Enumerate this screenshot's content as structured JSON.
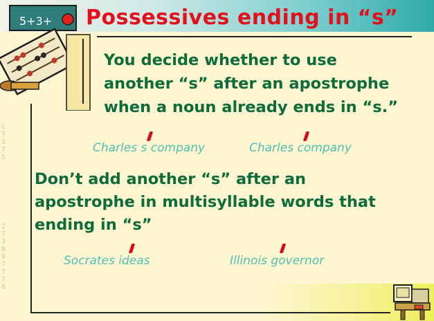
{
  "slide": {
    "title": "Possessives ending in “s”",
    "rule1": "You decide whether to use\nanother “s” after an apostrophe\nwhen a noun already ends in “s.”",
    "example1a": "Charles s company",
    "example1b": "Charles   company",
    "rule2": "Don’t add another “s” after an\napostrophe in multisyllable words that\nending in “s”",
    "example2a": "Socrates  ideas",
    "example2b": "Illinois  governor",
    "side_text_1": "CTSTS",
    "side_text_2": "273807770",
    "colors": {
      "title": "#e3101e",
      "body": "#0e6b3a",
      "example": "#4fc0b4",
      "apostrophe": "#d40d12",
      "background": "#fdf6d0"
    }
  }
}
